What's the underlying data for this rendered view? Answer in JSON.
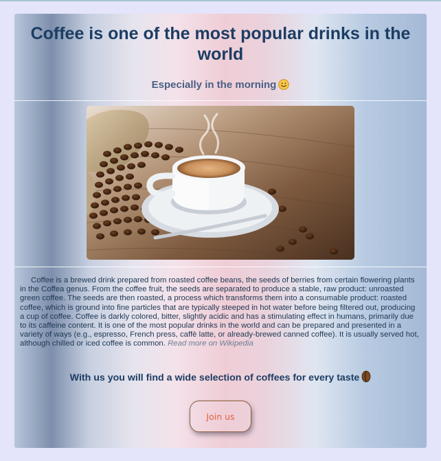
{
  "header": {
    "title": "Coffee is one of the most popular drinks in the world",
    "subtitle": "Especially in the morning",
    "subtitle_icon": "smiling-face-emoji"
  },
  "hero_image": {
    "alt": "Cup of coffee with saucer and spoon next to a burlap sack spilling roasted coffee beans on a wooden table"
  },
  "description": {
    "text": "Coffee is a brewed drink prepared from roasted coffee beans, the seeds of berries from certain flowering plants in the Coffea genus. From the coffee fruit, the seeds are separated to produce a stable, raw product: unroasted green coffee. The seeds are then roasted, a process which transforms them into a consumable product: roasted coffee, which is ground into fine particles that are typically steeped in hot water before being filtered out, producing a cup of coffee. Coffee is darkly colored, bitter, slightly acidic and has a stimulating effect in humans, primarily due to its caffeine content. It is one of the most popular drinks in the world and can be prepared and presented in a variety of ways (e.g., espresso, French press, caffè latte, or already-brewed canned coffee). It is usually served hot, although chilled or iced coffee is common.",
    "link_label": "Read more on Wikipedia"
  },
  "tagline": {
    "text": "With us you will find a wide selection of coffees for every taste",
    "icon": "coffee-bean-icon"
  },
  "cta": {
    "label": "Join us"
  },
  "colors": {
    "title": "#1d3d63",
    "subtitle": "#4a5f84",
    "body_text": "#1f3853",
    "link": "#6d7e95",
    "button_text": "#e0633d",
    "button_border": "#8b5a3a",
    "page_background": "#e4e4fa"
  }
}
